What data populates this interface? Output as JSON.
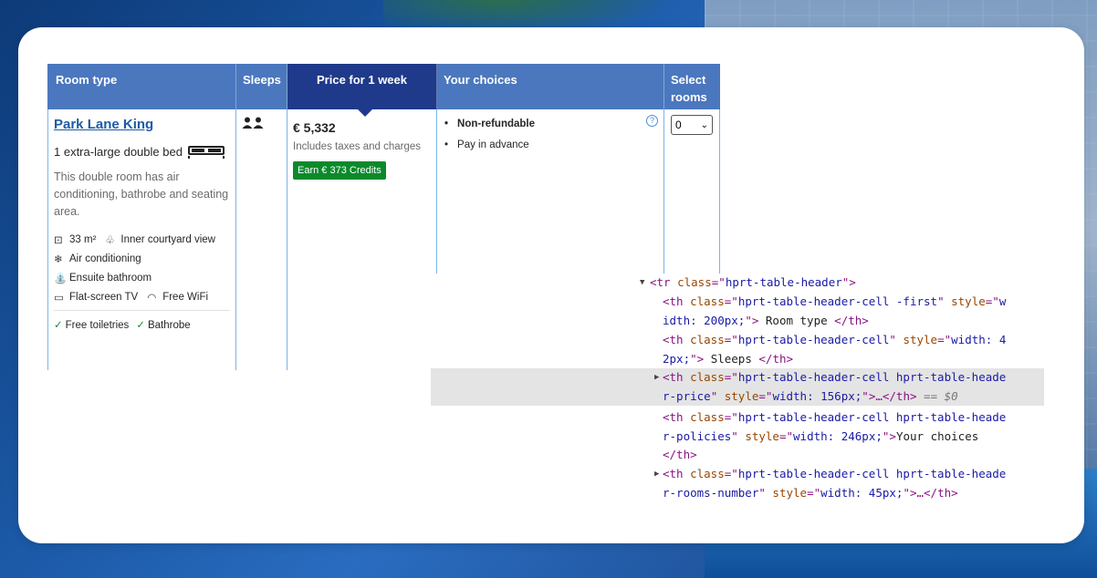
{
  "table": {
    "headers": {
      "room_type": "Room type",
      "sleeps": "Sleeps",
      "price": "Price for 1 week",
      "choices": "Your choices",
      "select": "Select rooms"
    },
    "room": {
      "name": "Park Lane King",
      "bed": "1 extra-large double bed",
      "description": "This double room has air conditioning, bathrobe and seating area.",
      "size": "33 m²",
      "view": "Inner courtyard view",
      "aircon": "Air conditioning",
      "bathroom": "Ensuite bathroom",
      "tv": "Flat-screen TV",
      "wifi": "Free WiFi",
      "toiletries": "Free toiletries",
      "bathrobe": "Bathrobe"
    },
    "price": {
      "amount": "€ 5,332",
      "taxes": "Includes taxes and charges",
      "credits": "Earn € 373 Credits"
    },
    "choices": {
      "non_refundable": "Non-refundable",
      "pay": "Pay in advance"
    },
    "select_value": "0"
  },
  "devtools": {
    "lines": [
      {
        "indent": 0,
        "triangle": "open",
        "html": "<tr class=\"hprt-table-header\">"
      },
      {
        "indent": 1,
        "html": "<th class=\"hprt-table-header-cell -first\" style=\"width: 200px;\"> Room type </th>"
      },
      {
        "indent": 1,
        "html": "<th class=\"hprt-table-header-cell\" style=\"width: 42px;\"> Sleeps </th>"
      },
      {
        "indent": 1,
        "triangle": "closed",
        "selected": true,
        "html": "<th class=\"hprt-table-header-cell hprt-table-header-price\" style=\"width: 156px;\">…</th> == $0"
      },
      {
        "indent": 1,
        "html": "<th class=\"hprt-table-header-cell hprt-table-header-policies\" style=\"width: 246px;\">Your choices </th>"
      },
      {
        "indent": 1,
        "triangle": "closed",
        "html": "<th class=\"hprt-table-header-cell hprt-table-header-rooms-number\" style=\"width: 45px;\">…</th>"
      }
    ]
  }
}
